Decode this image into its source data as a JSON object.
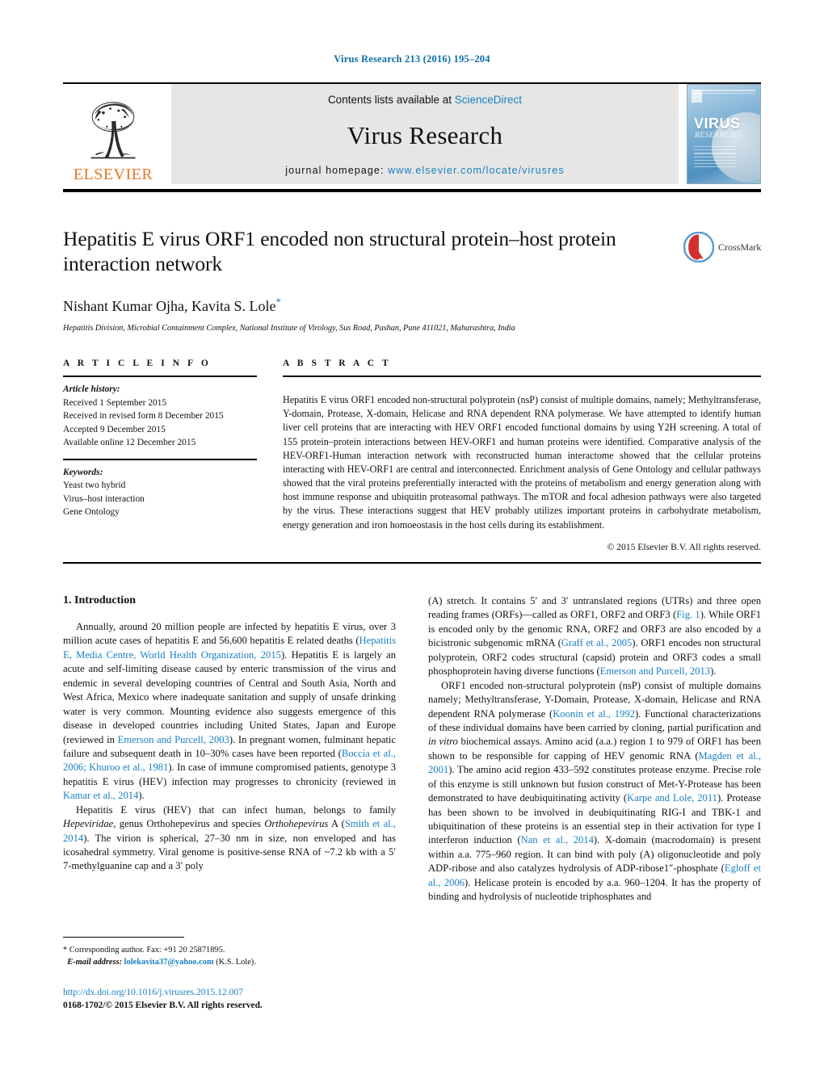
{
  "running_head": "Virus Research 213 (2016) 195–204",
  "masthead": {
    "publisher_name": "ELSEVIER",
    "contents_prefix": "Contents lists available at ",
    "contents_link": "ScienceDirect",
    "journal_name": "Virus Research",
    "homepage_prefix": "journal homepage: ",
    "homepage_url": "www.elsevier.com/locate/virusres",
    "cover_title": "VIRUS",
    "cover_subtitle": "RESEARCH"
  },
  "title_block": {
    "title": "Hepatitis E virus ORF1 encoded non structural protein–host protein interaction network",
    "authors": "Nishant Kumar Ojha, Kavita S. Lole",
    "corresponding_marker": "*",
    "affiliation": "Hepatitis Division, Microbial Containment Complex, National Institute of Virology, Sus Road, Pashan, Pune 411021, Maharashtra, India",
    "crossmark_label": "CrossMark"
  },
  "article_info": {
    "heading": "A R T I C L E   I N F O",
    "history_label": "Article history:",
    "history": [
      "Received 1 September 2015",
      "Received in revised form 8 December 2015",
      "Accepted 9 December 2015",
      "Available online 12 December 2015"
    ],
    "keywords_label": "Keywords:",
    "keywords": [
      "Yeast two hybrid",
      "Virus–host interaction",
      "Gene Ontology"
    ]
  },
  "abstract": {
    "heading": "A B S T R A C T",
    "text": "Hepatitis E virus ORF1 encoded non-structural polyprotein (nsP) consist of multiple domains, namely; Methyltransferase, Y-domain, Protease, X-domain, Helicase and RNA dependent RNA polymerase. We have attempted to identify human liver cell proteins that are interacting with HEV ORF1 encoded functional domains by using Y2H screening. A total of 155 protein–protein interactions between HEV-ORF1 and human proteins were identified. Comparative analysis of the HEV-ORF1-Human interaction network with reconstructed human interactome showed that the cellular proteins interacting with HEV-ORF1 are central and interconnected. Enrichment analysis of Gene Ontology and cellular pathways showed that the viral proteins preferentially interacted with the proteins of metabolism and energy generation along with host immune response and ubiquitin proteasomal pathways. The mTOR and focal adhesion pathways were also targeted by the virus. These interactions suggest that HEV probably utilizes important proteins in carbohydrate metabolism, energy generation and iron homoeostasis in the host cells during its establishment.",
    "copyright": "© 2015 Elsevier B.V. All rights reserved."
  },
  "introduction": {
    "heading": "1.  Introduction",
    "left_paragraphs": [
      {
        "segments": [
          {
            "t": "Annually, around 20 million people are infected by hepatitis E virus, over 3 million acute cases of hepatitis E and 56,600 hepatitis E related deaths (",
            "k": "n"
          },
          {
            "t": "Hepatitis E, Media Centre, World Health Organization, 2015",
            "k": "r"
          },
          {
            "t": "). Hepatitis E is largely an acute and self-limiting disease caused by enteric transmission of the virus and endemic in several developing countries of Central and South Asia, North and West Africa, Mexico where inadequate sanitation and supply of unsafe drinking water is very common. Mounting evidence also suggests emergence of this disease in developed countries including United States, Japan and Europe (reviewed in ",
            "k": "n"
          },
          {
            "t": "Emerson and Purcell, 2003",
            "k": "r"
          },
          {
            "t": "). In pregnant women, fulminant hepatic failure and subsequent death in 10–30% cases have been reported (",
            "k": "n"
          },
          {
            "t": "Boccia et al., 2006; Khuroo et al., 1981",
            "k": "r"
          },
          {
            "t": "). In case of immune compromised patients, genotype 3 hepatitis E virus (HEV) infection may progresses to chronicity (reviewed in ",
            "k": "n"
          },
          {
            "t": "Kamar et al., 2014",
            "k": "r"
          },
          {
            "t": ").",
            "k": "n"
          }
        ]
      },
      {
        "segments": [
          {
            "t": "Hepatitis E virus (HEV) that can infect human, belongs to family ",
            "k": "n"
          },
          {
            "t": "Hepeviridae",
            "k": "i"
          },
          {
            "t": ", genus Orthohepevirus and species ",
            "k": "n"
          },
          {
            "t": "Orthohepevirus",
            "k": "i"
          },
          {
            "t": " A (",
            "k": "n"
          },
          {
            "t": "Smith et al., 2014",
            "k": "r"
          },
          {
            "t": "). The virion is spherical, 27–30 nm in size, non enveloped and has icosahedral symmetry. Viral genome is positive-sense RNA of ~7.2 kb with a 5′ 7-methylguanine cap and a 3′ poly",
            "k": "n"
          }
        ]
      }
    ],
    "right_paragraphs": [
      {
        "first": true,
        "segments": [
          {
            "t": "(A) stretch. It contains 5′ and 3′ untranslated regions (UTRs) and three open reading frames (ORFs)—called as ORF1, ORF2 and ORF3 (",
            "k": "n"
          },
          {
            "t": "Fig. 1",
            "k": "r"
          },
          {
            "t": "). While ORF1 is encoded only by the genomic RNA, ORF2 and ORF3 are also encoded by a bicistronic subgenomic mRNA (",
            "k": "n"
          },
          {
            "t": "Graff et al., 2005",
            "k": "r"
          },
          {
            "t": "). ORF1 encodes non structural polyprotein, ORF2 codes structural (capsid) protein and ORF3 codes a small phosphoprotein having diverse functions (",
            "k": "n"
          },
          {
            "t": "Emerson and Purcell, 2013",
            "k": "r"
          },
          {
            "t": ").",
            "k": "n"
          }
        ]
      },
      {
        "segments": [
          {
            "t": "ORF1 encoded non-structural polyprotein (nsP) consist of multiple domains namely; Methyltransferase, Y-Domain, Protease, X-domain, Helicase and RNA dependent RNA polymerase (",
            "k": "n"
          },
          {
            "t": "Koonin et al., 1992",
            "k": "r"
          },
          {
            "t": "). Functional characterizations of these individual domains have been carried by cloning, partial purification and ",
            "k": "n"
          },
          {
            "t": "in vitro",
            "k": "i"
          },
          {
            "t": " biochemical assays. Amino acid (a.a.) region 1 to 979 of ORF1 has been shown to be responsible for capping of HEV genomic RNA (",
            "k": "n"
          },
          {
            "t": "Magden et al., 2001",
            "k": "r"
          },
          {
            "t": "). The amino acid region 433–592 constitutes protease enzyme. Precise role of this enzyme is still unknown but fusion construct of Met-Y-Protease has been demonstrated to have deubiquitinating activity (",
            "k": "n"
          },
          {
            "t": "Karpe and Lole, 2011",
            "k": "r"
          },
          {
            "t": "). Protease has been shown to be involved in deubiquitinating RIG-I and TBK-1 and ubiquitination of these proteins is an essential step in their activation for type I interferon induction (",
            "k": "n"
          },
          {
            "t": "Nan et al., 2014",
            "k": "r"
          },
          {
            "t": "). X-domain (macrodomain) is present within a.a. 775–960 region. It can bind with poly (A) oligonucleotide and poly ADP-ribose and also catalyzes hydrolysis of ADP-ribose1″-phosphate (",
            "k": "n"
          },
          {
            "t": "Egloff et al., 2006",
            "k": "r"
          },
          {
            "t": "). Helicase protein is encoded by a.a. 960–1204. It has the property of binding and hydrolysis of nucleotide triphosphates and",
            "k": "n"
          }
        ]
      }
    ]
  },
  "footer": {
    "corresponding_marker": "*",
    "corresponding_text": "Corresponding author. Fax: +91 20 25871895.",
    "email_label": "E-mail address:",
    "email": "lolekavita37@yahoo.com",
    "email_suffix": "(K.S. Lole).",
    "doi": "http://dx.doi.org/10.1016/j.virusres.2015.12.007",
    "issn_line": "0168-1702/© 2015 Elsevier B.V. All rights reserved."
  },
  "colors": {
    "link": "#1a7fc1",
    "elsevier_orange": "#E87722",
    "band": "#e6e6e6"
  }
}
